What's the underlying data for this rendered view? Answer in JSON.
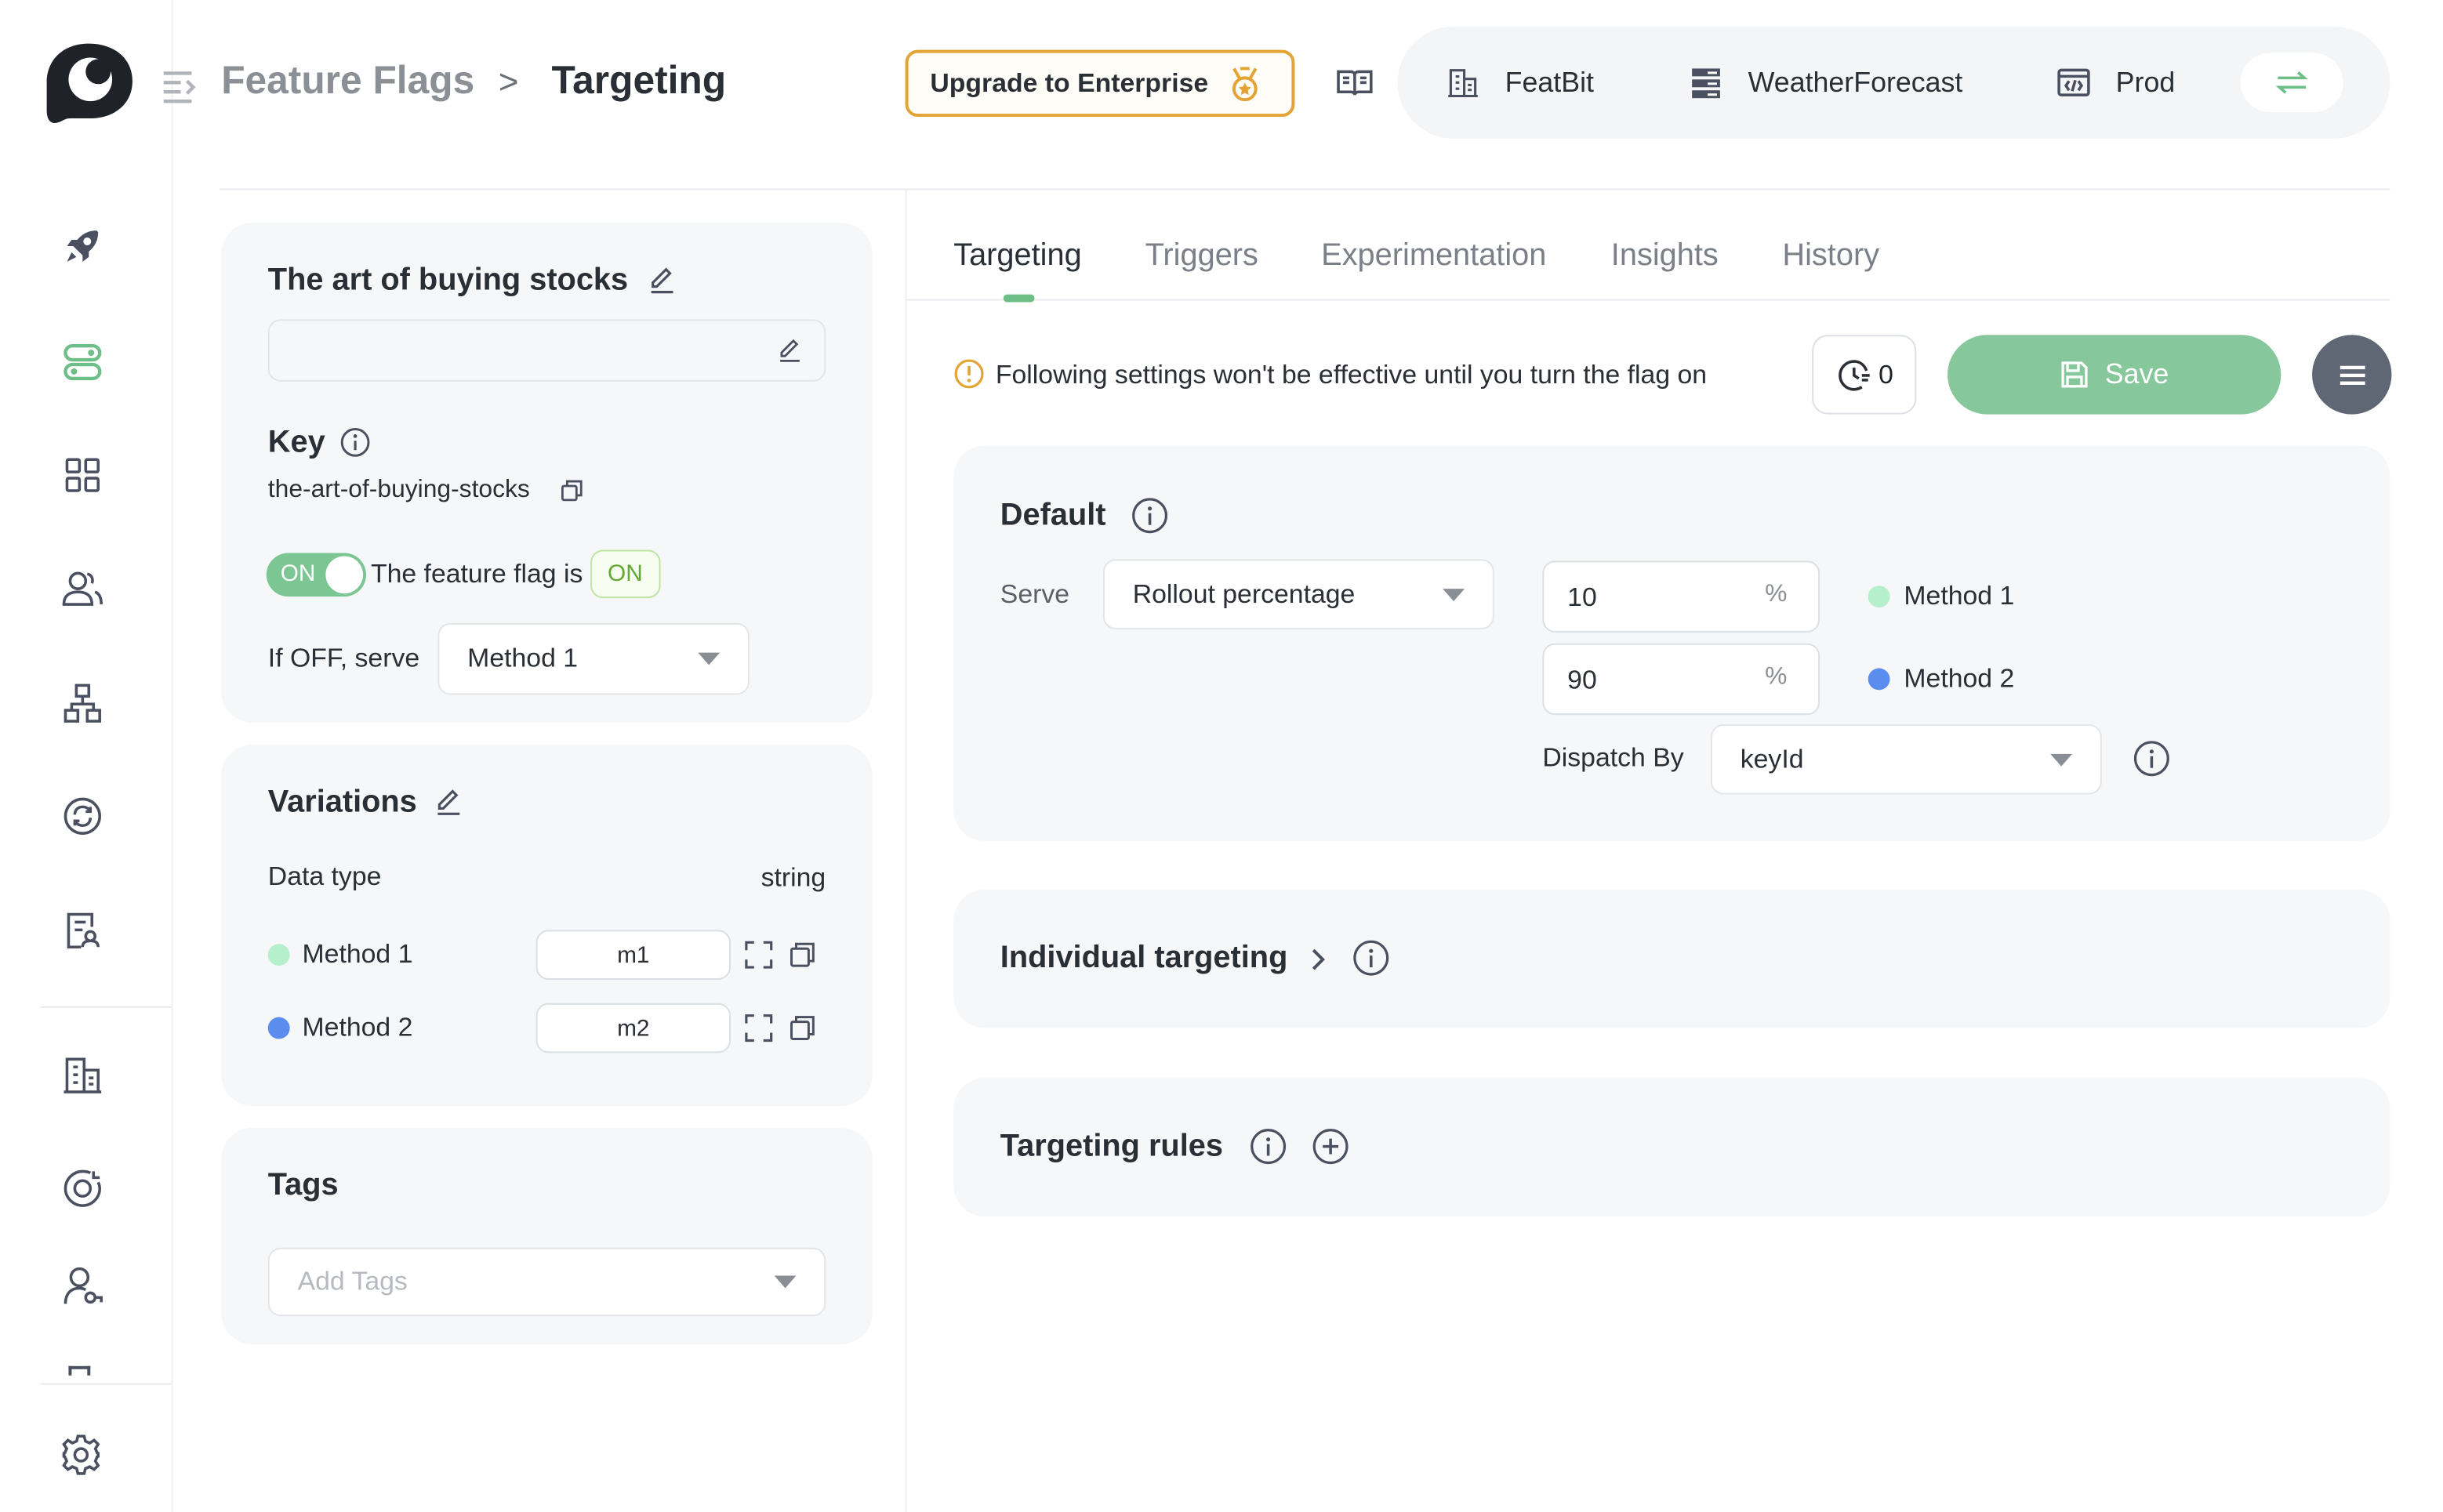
{
  "breadcrumb": {
    "parent": "Feature Flags",
    "separator": ">",
    "current": "Targeting"
  },
  "header": {
    "upgrade_label": "Upgrade to Enterprise",
    "organization": "FeatBit",
    "project": "WeatherForecast",
    "environment": "Prod"
  },
  "sidebar": {
    "items": [
      "rocket-icon",
      "toggle-icon",
      "grid-icon",
      "users-icon",
      "hierarchy-icon",
      "refresh-icon",
      "report-icon",
      "building-icon",
      "target-icon",
      "user-key-icon",
      "settings-icon"
    ]
  },
  "flag": {
    "name": "The art of buying stocks",
    "description": "",
    "key_label": "Key",
    "key": "the-art-of-buying-stocks",
    "toggle_label": "ON",
    "status_text": "The feature flag is",
    "status_badge": "ON",
    "off_serve_label": "If OFF, serve",
    "off_serve_value": "Method 1"
  },
  "variations": {
    "title": "Variations",
    "data_type_label": "Data type",
    "data_type": "string",
    "items": [
      {
        "name": "Method 1",
        "value": "m1",
        "color": "#b5efcc"
      },
      {
        "name": "Method 2",
        "value": "m2",
        "color": "#5b8def"
      }
    ]
  },
  "tags": {
    "title": "Tags",
    "placeholder": "Add Tags"
  },
  "tabs": [
    {
      "label": "Targeting",
      "active": true
    },
    {
      "label": "Triggers",
      "active": false
    },
    {
      "label": "Experimentation",
      "active": false
    },
    {
      "label": "Insights",
      "active": false
    },
    {
      "label": "History",
      "active": false
    }
  ],
  "notice": "Following settings won't be effective until you turn the flag on",
  "history_count": "0",
  "save_label": "Save",
  "default_rule": {
    "title": "Default",
    "serve_label": "Serve",
    "serve_value": "Rollout percentage",
    "rollouts": [
      {
        "percent": "10",
        "unit": "%",
        "variation": "Method 1",
        "color": "#b5efcc"
      },
      {
        "percent": "90",
        "unit": "%",
        "variation": "Method 2",
        "color": "#5b8def"
      }
    ],
    "dispatch_label": "Dispatch By",
    "dispatch_value": "keyId"
  },
  "individual_targeting": {
    "title": "Individual targeting"
  },
  "targeting_rules": {
    "title": "Targeting rules"
  },
  "colors": {
    "accent": "#6dbf87",
    "upgrade_border": "#e3a335",
    "save": "#86c79b"
  }
}
